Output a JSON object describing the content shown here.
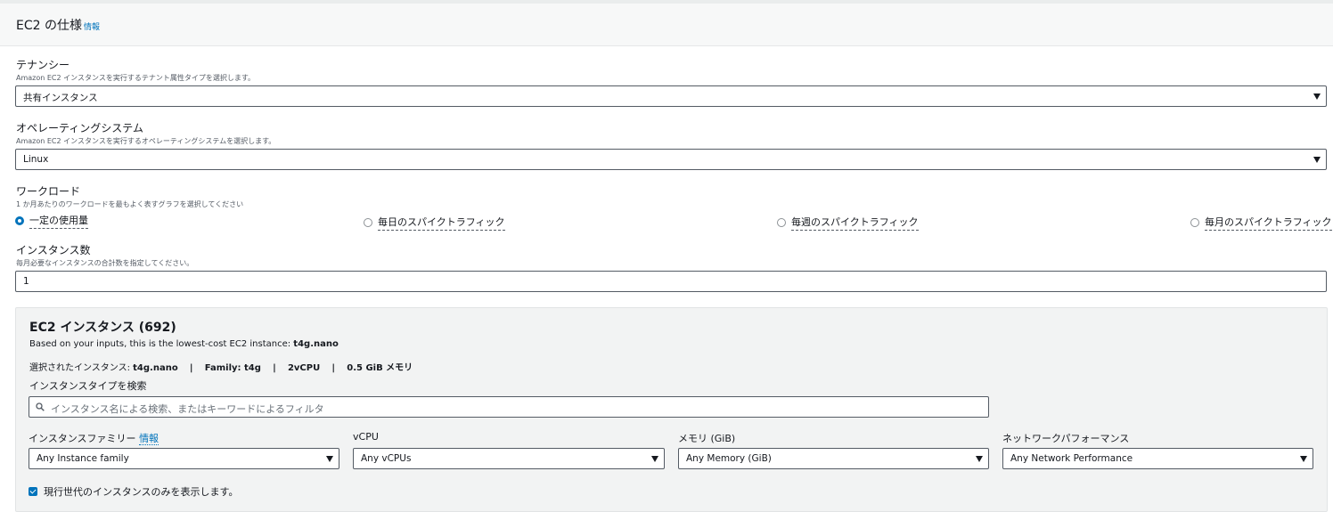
{
  "header": {
    "title": "EC2 の仕様",
    "info_link": "情報"
  },
  "tenancy": {
    "label": "テナンシー",
    "description": "Amazon EC2 インスタンスを実行するテナント属性タイプを選択します。",
    "selected": "共有インスタンス"
  },
  "os": {
    "label": "オペレーティングシステム",
    "description": "Amazon EC2 インスタンスを実行するオペレーティングシステムを選択します。",
    "selected": "Linux"
  },
  "workload": {
    "label": "ワークロード",
    "description": "1 か月あたりのワークロードを最もよく表すグラフを選択してください",
    "options": [
      {
        "label": "一定の使用量",
        "checked": true
      },
      {
        "label": "毎日のスパイクトラフィック",
        "checked": false
      },
      {
        "label": "毎週のスパイクトラフィック",
        "checked": false
      },
      {
        "label": "毎月のスパイクトラフィック",
        "checked": false
      }
    ]
  },
  "instance_count": {
    "label": "インスタンス数",
    "description": "毎月必要なインスタンスの合計数を指定してください。",
    "value": "1"
  },
  "ec2_panel": {
    "title": "EC2 インスタンス (692)",
    "lowest_cost_prefix": "Based on your inputs, this is the lowest-cost EC2 instance: ",
    "lowest_cost_instance": "t4g.nano",
    "selected_prefix": "選択されたインスタンス: ",
    "selected_instance": "t4g.nano",
    "sep": "|",
    "family": "Family: t4g",
    "vcpu": "2vCPU",
    "memory": "0.5 GiB メモリ",
    "search_label": "インスタンスタイプを検索",
    "search_placeholder": "インスタンス名による検索、またはキーワードによるフィルタ",
    "filters": [
      {
        "label": "インスタンスファミリー",
        "link": "情報",
        "value": "Any Instance family"
      },
      {
        "label": "vCPU",
        "value": "Any vCPUs"
      },
      {
        "label": "メモリ (GiB)",
        "value": "Any Memory (GiB)"
      },
      {
        "label": "ネットワークパフォーマンス",
        "value": "Any Network Performance"
      }
    ],
    "checkbox_label": "現行世代のインスタンスのみを表示します。",
    "checkbox_checked": true
  }
}
